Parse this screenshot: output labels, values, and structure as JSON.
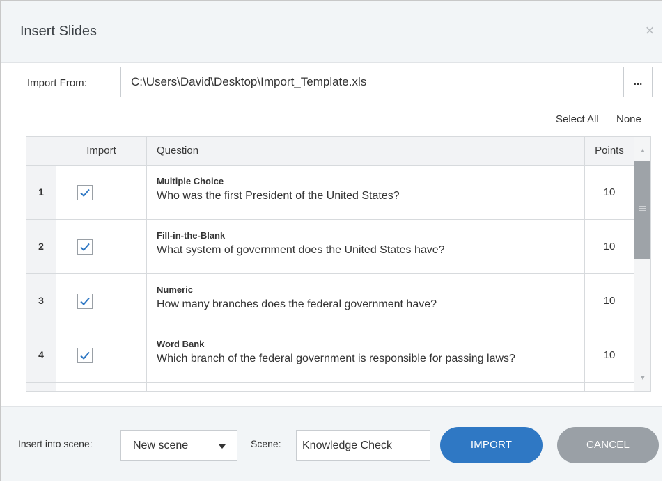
{
  "dialog": {
    "title": "Insert Slides",
    "close_glyph": "×"
  },
  "import_from": {
    "label": "Import From:",
    "value": "C:\\Users\\David\\Desktop\\Import_Template.xls",
    "browse_label": "..."
  },
  "selection_links": {
    "select_all": "Select All",
    "none": "None"
  },
  "table": {
    "columns": [
      "Import",
      "Question",
      "Points"
    ],
    "rows": [
      {
        "num": "1",
        "checked": true,
        "type": "Multiple Choice",
        "question": "Who was the first President of the United States?",
        "points": "10"
      },
      {
        "num": "2",
        "checked": true,
        "type": "Fill-in-the-Blank",
        "question": "What system of government does the United States have?",
        "points": "10"
      },
      {
        "num": "3",
        "checked": true,
        "type": "Numeric",
        "question": "How many branches does the federal government have?",
        "points": "10"
      },
      {
        "num": "4",
        "checked": true,
        "type": "Word Bank",
        "question": "Which branch of the federal government is responsible for passing laws?",
        "points": "10"
      }
    ],
    "check_glyph": "✓",
    "scroll_up_glyph": "▲",
    "scroll_down_glyph": "▼"
  },
  "footer": {
    "insert_into_scene_label": "Insert into scene:",
    "scene_select_value": "New scene",
    "scene_label": "Scene:",
    "scene_input_value": "Knowledge Check",
    "import_button": "IMPORT",
    "cancel_button": "CANCEL"
  },
  "colors": {
    "accent": "#2f78c4",
    "checkmark": "#2f78c4",
    "cancel": "#9aa0a6",
    "titlebar_bg": "#f2f5f7"
  }
}
